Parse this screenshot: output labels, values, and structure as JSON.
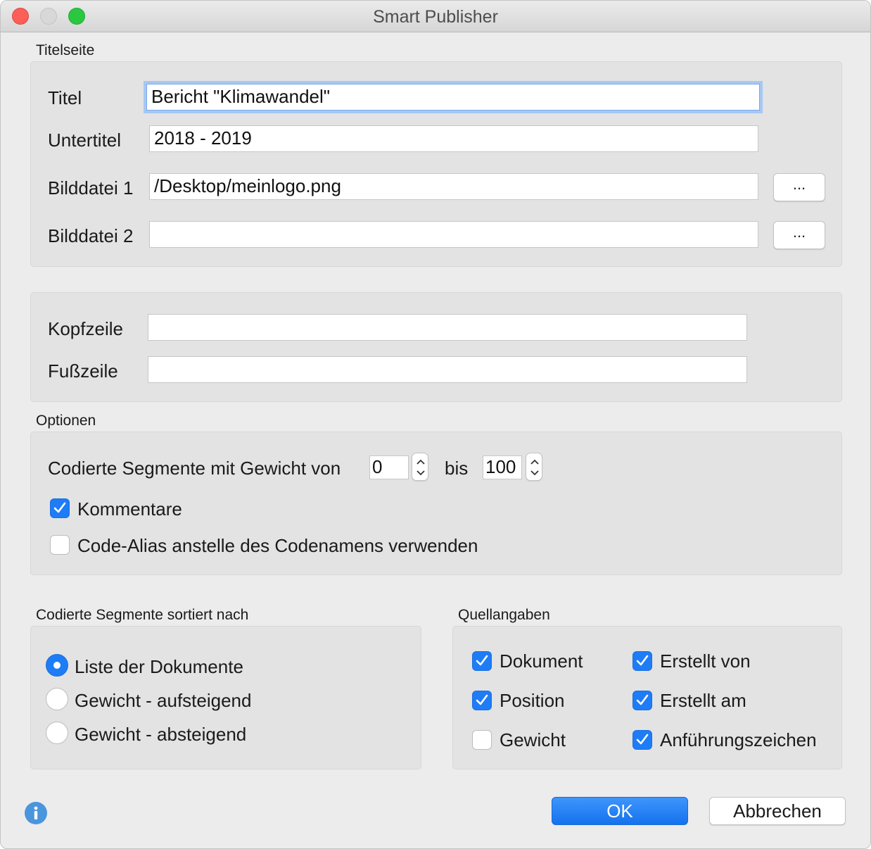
{
  "window": {
    "title": "Smart Publisher"
  },
  "titelseite": {
    "section_label": "Titelseite",
    "titel": {
      "label": "Titel",
      "value": "Bericht \"Klimawandel\""
    },
    "untertitel": {
      "label": "Untertitel",
      "value": "2018 - 2019"
    },
    "bilddatei1": {
      "label": "Bilddatei 1",
      "value": "/Desktop/meinlogo.png",
      "browse_label": "..."
    },
    "bilddatei2": {
      "label": "Bilddatei 2",
      "value": "",
      "browse_label": "..."
    }
  },
  "kopf_fuss": {
    "kopfzeile": {
      "label": "Kopfzeile",
      "value": ""
    },
    "fusszeile": {
      "label": "Fußzeile",
      "value": ""
    }
  },
  "optionen": {
    "section_label": "Optionen",
    "weight_label": "Codierte Segmente mit Gewicht von",
    "weight_from": "0",
    "bis_label": "bis",
    "weight_to": "100",
    "kommentare": {
      "label": "Kommentare",
      "checked": true
    },
    "code_alias": {
      "label": "Code-Alias anstelle des Codenamens verwenden",
      "checked": false
    }
  },
  "sortierung": {
    "section_label": "Codierte Segmente sortiert nach",
    "options": [
      {
        "label": "Liste der Dokumente",
        "selected": true
      },
      {
        "label": "Gewicht - aufsteigend",
        "selected": false
      },
      {
        "label": "Gewicht - absteigend",
        "selected": false
      }
    ]
  },
  "quellangaben": {
    "section_label": "Quellangaben",
    "items": [
      {
        "label": "Dokument",
        "checked": true
      },
      {
        "label": "Erstellt von",
        "checked": true
      },
      {
        "label": "Position",
        "checked": true
      },
      {
        "label": "Erstellt am",
        "checked": true
      },
      {
        "label": "Gewicht",
        "checked": false
      },
      {
        "label": "Anführungszeichen",
        "checked": true
      }
    ]
  },
  "buttons": {
    "ok": "OK",
    "cancel": "Abbrechen"
  },
  "icons": {
    "info": "info-icon",
    "checkbox_check": "checkmark-icon"
  },
  "colors": {
    "accent": "#1e7cf7",
    "panel": "#e3e3e3",
    "window": "#ececec"
  }
}
